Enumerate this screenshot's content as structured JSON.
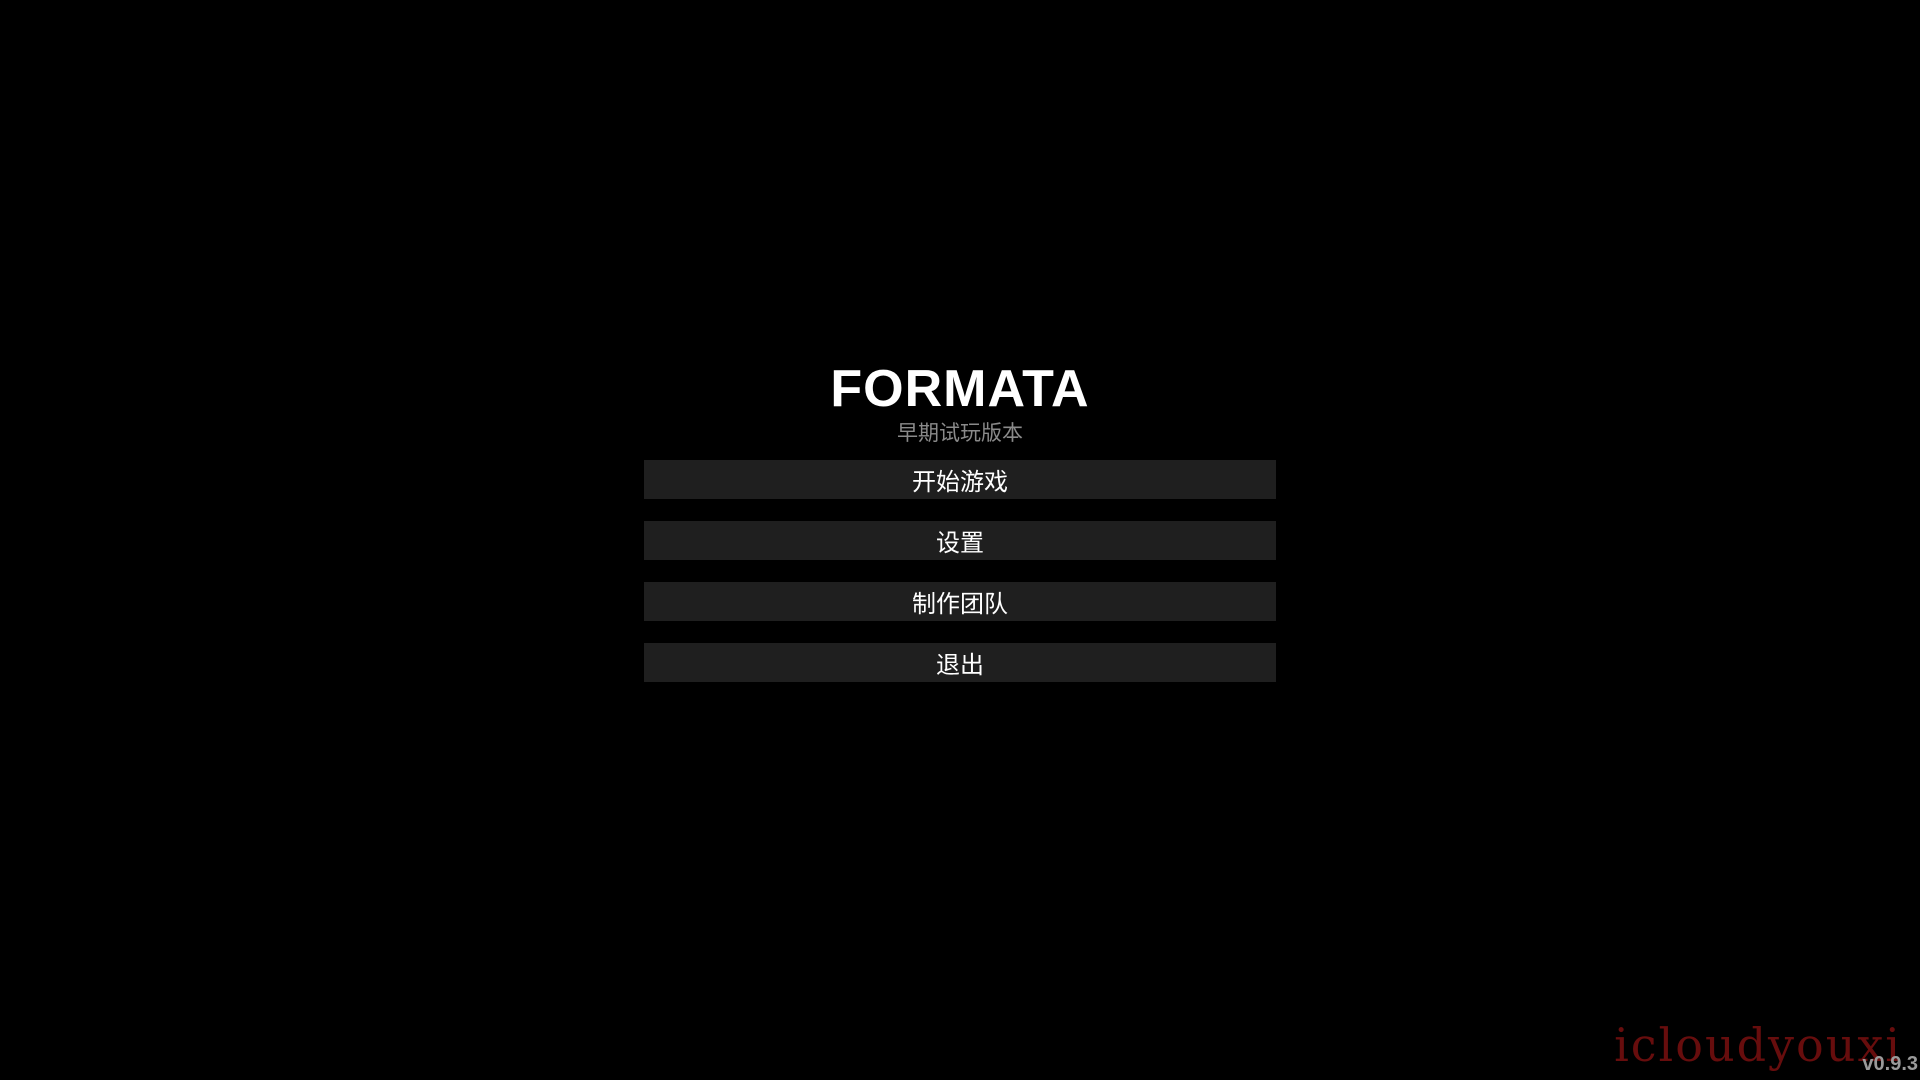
{
  "game": {
    "title": "FORMATA",
    "subtitle": "早期试玩版本"
  },
  "menu": {
    "items": [
      {
        "label": "开始游戏"
      },
      {
        "label": "设置"
      },
      {
        "label": "制作团队"
      },
      {
        "label": "退出"
      }
    ]
  },
  "footer": {
    "watermark": "icloudyouxi",
    "version": "v0.9.3"
  },
  "colors": {
    "background": "#000000",
    "button_background": "#1f1f1f",
    "title_text": "#ffffff",
    "subtitle_text": "#8a8a8a",
    "watermark": "#7a1010",
    "version_text": "#9a9a9a"
  }
}
